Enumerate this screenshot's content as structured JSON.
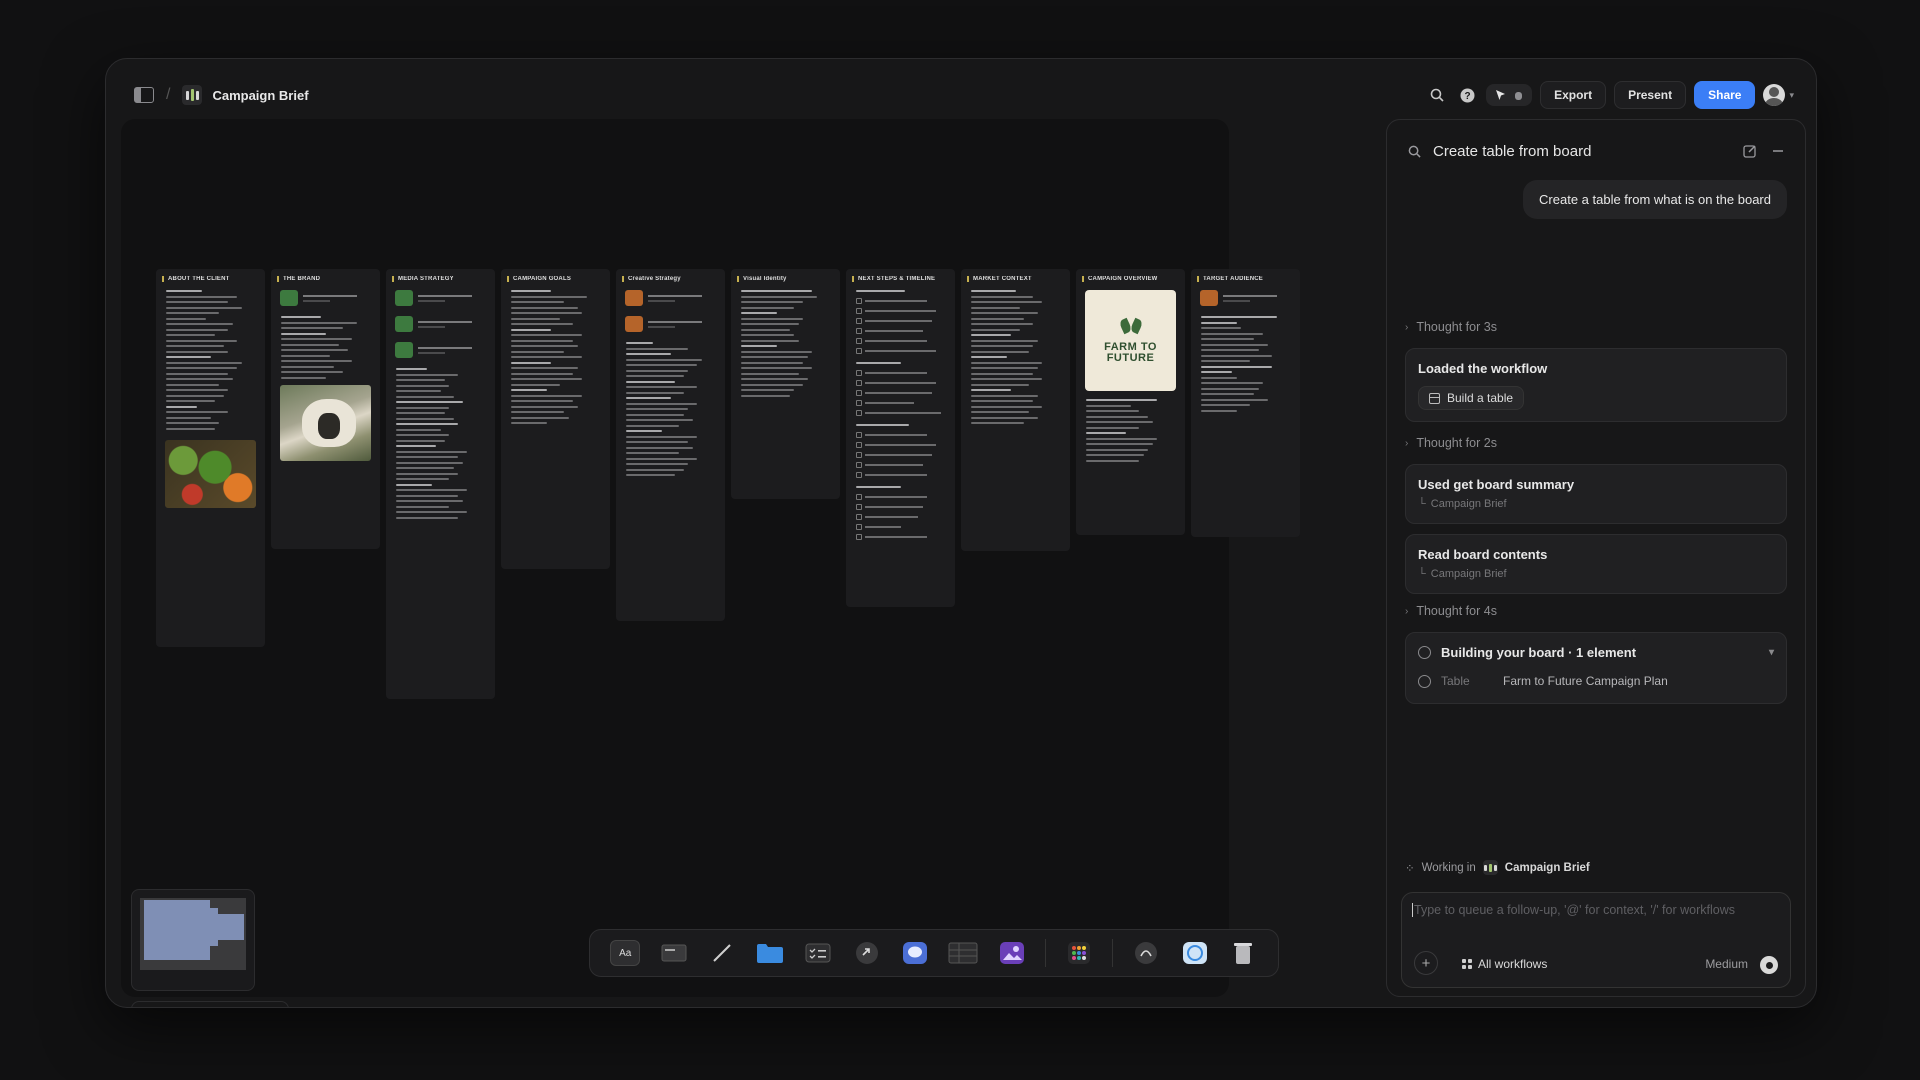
{
  "header": {
    "board_title": "Campaign Brief",
    "export_label": "Export",
    "present_label": "Present",
    "share_label": "Share"
  },
  "board": {
    "columns": [
      {
        "title": "ABOUT THE CLIENT"
      },
      {
        "title": "THE BRAND"
      },
      {
        "title": "MEDIA STRATEGY"
      },
      {
        "title": "CAMPAIGN GOALS"
      },
      {
        "title": "Creative Strategy"
      },
      {
        "title": "Visual Identity"
      },
      {
        "title": "NEXT STEPS & TIMELINE"
      },
      {
        "title": "MARKET CONTEXT"
      },
      {
        "title": "CAMPAIGN OVERVIEW"
      },
      {
        "title": "TARGET AUDIENCE"
      }
    ],
    "logo_text": [
      "FARM TO",
      "FUTURE"
    ]
  },
  "panel": {
    "title": "Create table from board",
    "user_message": "Create a table from what is on the board",
    "thought1": "Thought for 3s",
    "card1_title": "Loaded the workflow",
    "card1_pill": "Build a table",
    "thought2": "Thought for 2s",
    "card2_title": "Used get board summary",
    "card2_sub": "Campaign Brief",
    "card3_title": "Read board contents",
    "card3_sub": "Campaign Brief",
    "thought3": "Thought for 4s",
    "building_title": "Building your board · 1 element",
    "element_type": "Table",
    "element_name": "Farm to Future Campaign Plan",
    "working_prefix": "Working in",
    "working_board": "Campaign Brief",
    "composer_placeholder": "Type to queue a follow-up, '@' for context, '/' for workflows",
    "all_workflows": "All workflows",
    "model": "Medium"
  },
  "colors": {
    "accent": "#3b7ef6",
    "column_marker": "#c6b04f"
  }
}
